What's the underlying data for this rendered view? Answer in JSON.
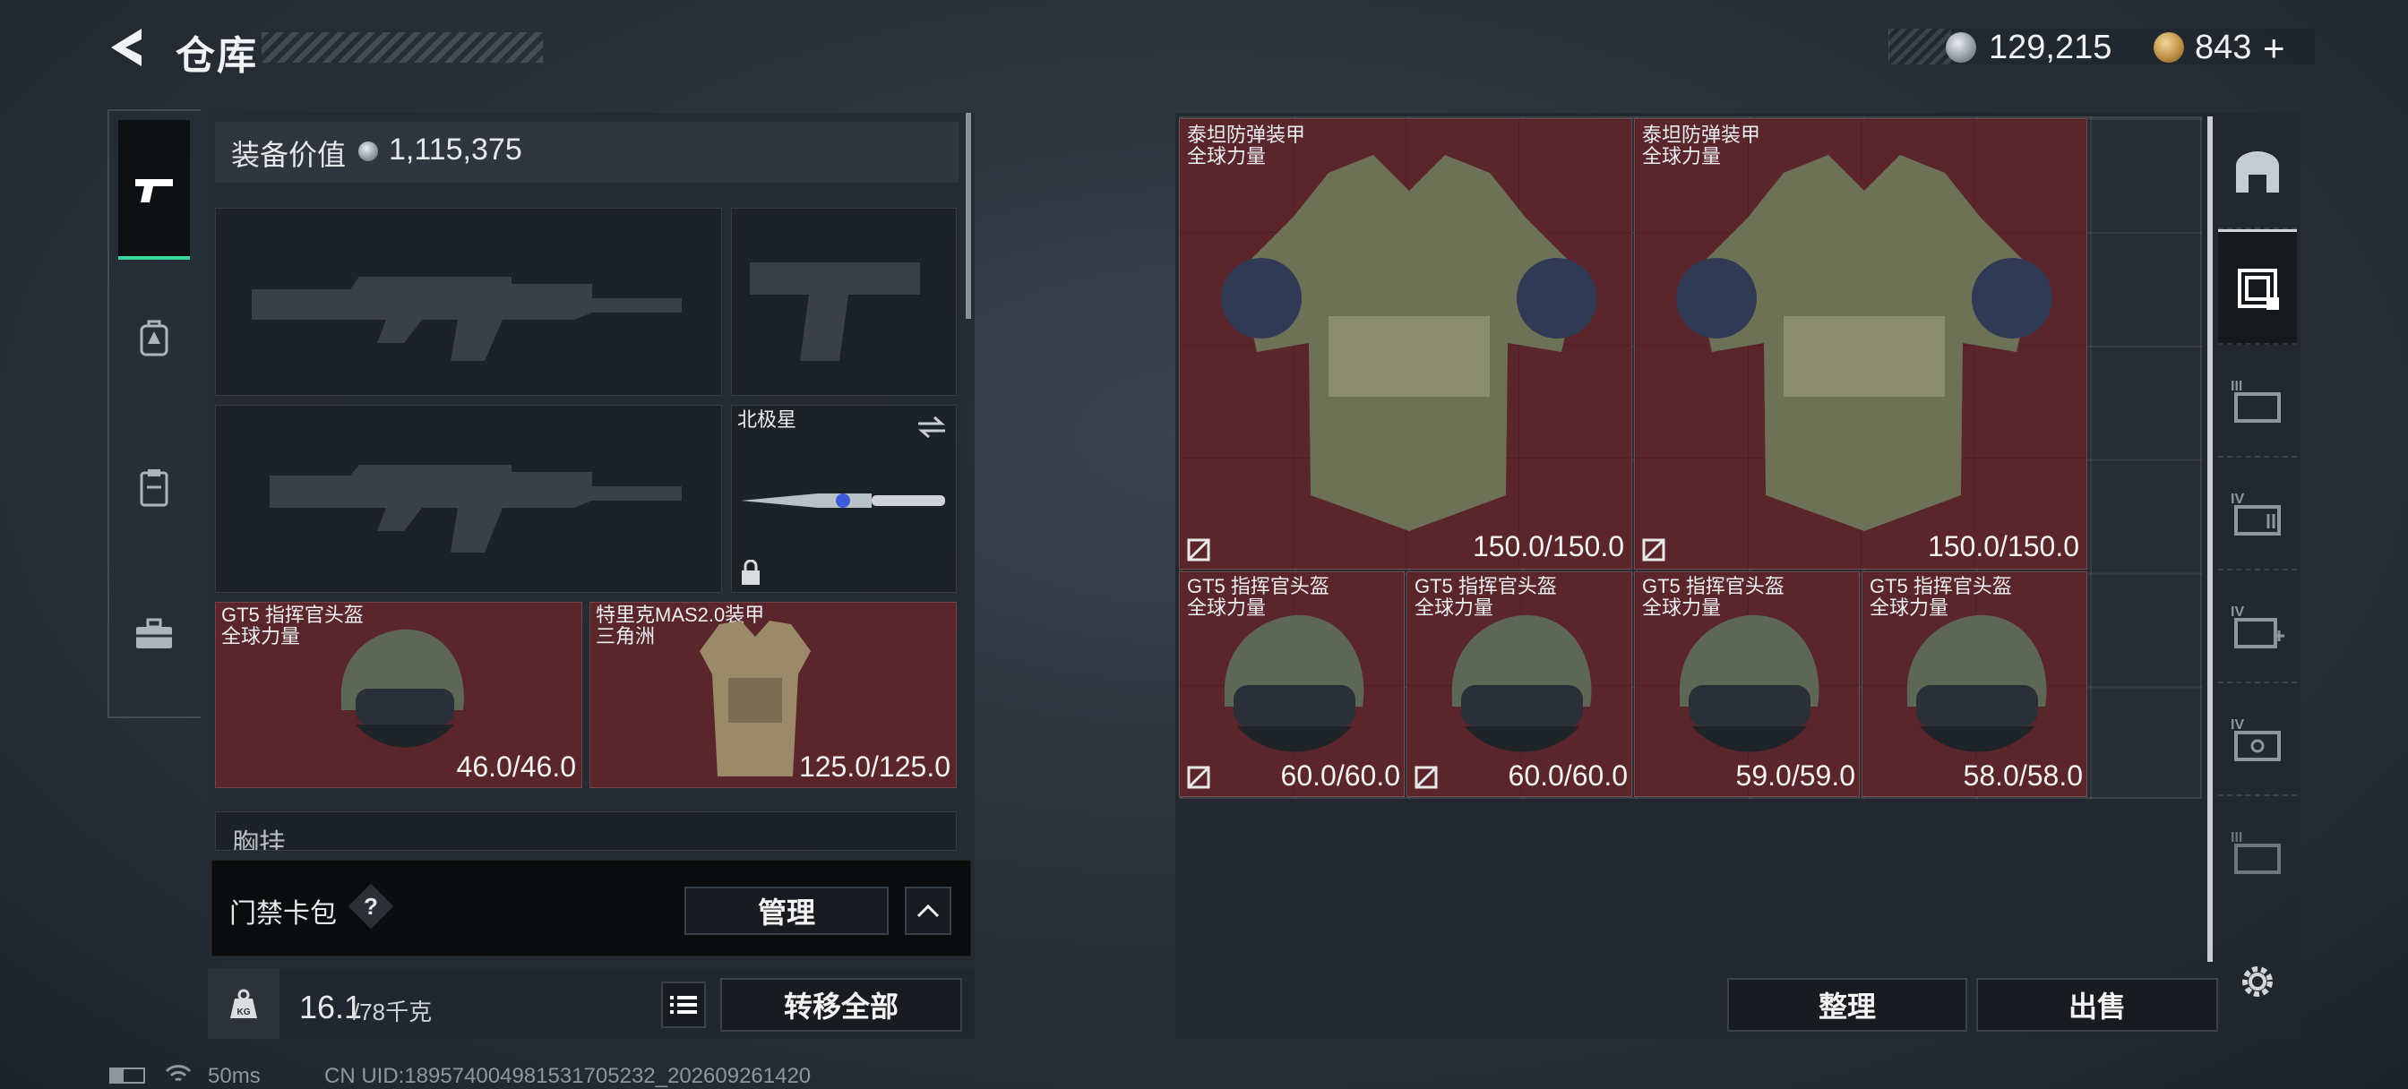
{
  "header": {
    "title": "仓库",
    "currency_silver": "129,215",
    "currency_gold": "843",
    "currency_add": "+"
  },
  "left_nav": {
    "items": [
      {
        "icon": "pistol-icon",
        "active": true
      },
      {
        "icon": "backpack-icon",
        "active": false
      },
      {
        "icon": "clipboard-icon",
        "active": false
      },
      {
        "icon": "toolbox-icon",
        "active": false
      }
    ]
  },
  "loadout": {
    "value_label": "装备价值",
    "value": "1,115,375",
    "melee": {
      "name": "北极星"
    },
    "helmet": {
      "name": "GT5 指挥官头盔",
      "brand": "全球力量",
      "durability": "46.0/46.0"
    },
    "armor": {
      "name": "特里克MAS2.0装甲",
      "brand": "三角洲",
      "durability": "125.0/125.0"
    },
    "chest_rig_partial": "胸挂",
    "keycard": {
      "label": "门禁卡包",
      "help": "?",
      "manage": "管理"
    },
    "weight": {
      "current": "16.1",
      "max": "/78千克",
      "unit_badge": "KG"
    },
    "transfer_all": "转移全部"
  },
  "storage": {
    "items": [
      {
        "name": "泰坦防弹装甲",
        "brand": "全球力量",
        "durability": "150.0/150.0"
      },
      {
        "name": "泰坦防弹装甲",
        "brand": "全球力量",
        "durability": "150.0/150.0"
      },
      {
        "name": "GT5 指挥官头盔",
        "brand": "全球力量",
        "durability": "60.0/60.0"
      },
      {
        "name": "GT5 指挥官头盔",
        "brand": "全球力量",
        "durability": "60.0/60.0"
      },
      {
        "name": "GT5 指挥官头盔",
        "brand": "全球力量",
        "durability": "59.0/59.0"
      },
      {
        "name": "GT5 指挥官头盔",
        "brand": "全球力量",
        "durability": "58.0/58.0"
      }
    ],
    "sort_button": "整理",
    "sell_button": "出售"
  },
  "right_nav": {
    "tabs": [
      {
        "icon": "safe-box-icon",
        "tier": ""
      },
      {
        "icon": "gear-case-icon",
        "tier": ""
      },
      {
        "icon": "case-iii-icon",
        "tier": "III"
      },
      {
        "icon": "case-iv-ammo-icon",
        "tier": "IV"
      },
      {
        "icon": "case-iv-medical-icon",
        "tier": "IV"
      },
      {
        "icon": "case-iv-key-icon",
        "tier": "IV"
      },
      {
        "icon": "case-iii-b-icon",
        "tier": "III"
      }
    ]
  },
  "footer": {
    "ping": "50ms",
    "uid": "CN UID:18957400498153170523​2_202609261420"
  }
}
